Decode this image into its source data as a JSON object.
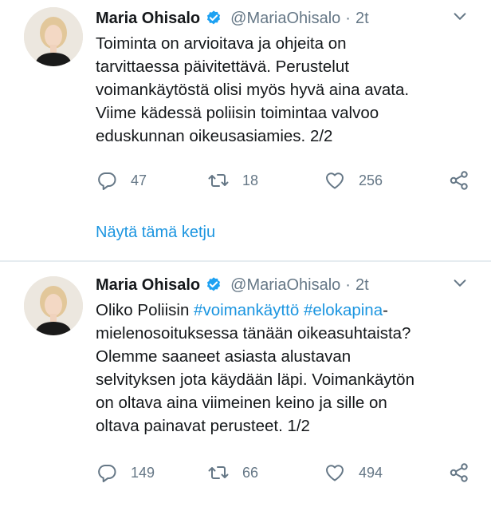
{
  "tweets": [
    {
      "author_name": "Maria Ohisalo",
      "handle": "@MariaOhisalo",
      "separator": "·",
      "time": "2t",
      "lines": [
        "Toiminta on arvioitava ja ohjeita on",
        "tarvittaessa päivitettävä. Perustelut",
        "voimankäytöstä olisi myös hyvä aina avata.",
        "Viime kädessä poliisin toimintaa valvoo",
        "eduskunnan oikeusasiamies. 2/2"
      ],
      "replies": "47",
      "retweets": "18",
      "likes": "256",
      "thread_link": "Näytä tämä ketju"
    },
    {
      "author_name": "Maria Ohisalo",
      "handle": "@MariaOhisalo",
      "separator": "·",
      "time": "2t",
      "line1_prefix": "Oliko Poliisin ",
      "hashtag1": "#voimankäyttö",
      "hashtag2": "#elokapina",
      "line1_suffix": "-",
      "lines": [
        "mielenosoituksessa tänään oikeasuhtaista?",
        "Olemme saaneet asiasta alustavan",
        "selvityksen jota käydään läpi. Voimankäytön",
        "on oltava aina viimeinen keino ja sille on",
        "oltava painavat perusteet. 1/2"
      ],
      "replies": "149",
      "retweets": "66",
      "likes": "494"
    }
  ],
  "icons": {
    "verified": "verified-badge-icon",
    "caret": "chevron-down-icon",
    "reply": "reply-icon",
    "retweet": "retweet-icon",
    "like": "heart-icon",
    "share": "share-icon"
  },
  "colors": {
    "link": "#1b95e0",
    "muted": "#657786",
    "text": "#14171a",
    "divider": "#e6ecf0"
  }
}
